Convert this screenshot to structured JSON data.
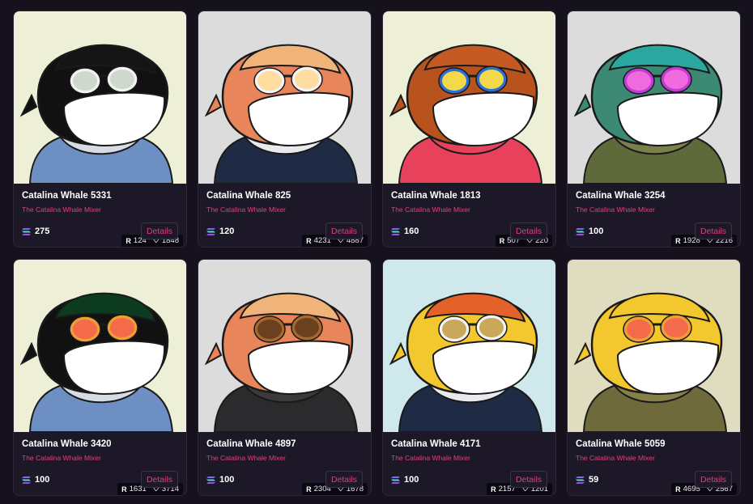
{
  "cards": [
    {
      "title": "Catalina Whale 5331",
      "collection": "The Catalina Whale Mixer",
      "rank": "124",
      "likes": "1848",
      "price": "275",
      "details_label": "Details",
      "bg": "#edf0d6",
      "body": "#111111",
      "hat": "#151515",
      "glasses": "#f2f2f2",
      "lens": "#cfd8cc",
      "outfit": "#6d8fc3",
      "hood": "#d7dbe3"
    },
    {
      "title": "Catalina Whale 825",
      "collection": "The Catalina Whale Mixer",
      "rank": "4231",
      "likes": "4887",
      "price": "120",
      "details_label": "Details",
      "bg": "#dcdcdc",
      "body": "#e8855a",
      "hat": "#f0b37a",
      "glasses": "#f4f4f4",
      "lens": "#ffdca0",
      "outfit": "#1f2a44",
      "hood": "#e9eaee"
    },
    {
      "title": "Catalina Whale 1813",
      "collection": "The Catalina Whale Mixer",
      "rank": "507",
      "likes": "220",
      "price": "160",
      "details_label": "Details",
      "bg": "#edf0d6",
      "body": "#b8531e",
      "hat": "#c45a22",
      "glasses": "#2a6fd6",
      "lens": "#f3d94a",
      "outfit": "#e8415c",
      "hood": "#e8415c"
    },
    {
      "title": "Catalina Whale 3254",
      "collection": "The Catalina Whale Mixer",
      "rank": "1928",
      "likes": "2216",
      "price": "100",
      "details_label": "Details",
      "bg": "#dcdcdc",
      "body": "#3c8a73",
      "hat": "#2aa8a0",
      "glasses": "#c23bd6",
      "lens": "#f06be0",
      "outfit": "#5f6a3a",
      "hood": "#7a7f4c"
    },
    {
      "title": "Catalina Whale 3420",
      "collection": "The Catalina Whale Mixer",
      "rank": "1631",
      "likes": "3714",
      "price": "100",
      "details_label": "Details",
      "bg": "#edf0d6",
      "body": "#111111",
      "hat": "#0d3b1f",
      "glasses": "#f0a032",
      "lens": "#f36b4a",
      "outfit": "#6d8fc3",
      "hood": "#d7dbe3"
    },
    {
      "title": "Catalina Whale 4897",
      "collection": "The Catalina Whale Mixer",
      "rank": "2304",
      "likes": "1678",
      "price": "100",
      "details_label": "Details",
      "bg": "#dcdcdc",
      "body": "#e8855a",
      "hat": "#f0b37a",
      "glasses": "#a86a2a",
      "lens": "#6b4020",
      "outfit": "#2b2b2e",
      "hood": "#3a3a3d"
    },
    {
      "title": "Catalina Whale 4171",
      "collection": "The Catalina Whale Mixer",
      "rank": "2157",
      "likes": "1201",
      "price": "100",
      "details_label": "Details",
      "bg": "#cfe8ec",
      "body": "#f2c82e",
      "hat": "#e4622a",
      "glasses": "#f4f4f4",
      "lens": "#c9a85a",
      "outfit": "#1f2a44",
      "hood": "#e9eaee"
    },
    {
      "title": "Catalina Whale 5059",
      "collection": "The Catalina Whale Mixer",
      "rank": "4695",
      "likes": "2567",
      "price": "59",
      "details_label": "Details",
      "bg": "#e0dcc0",
      "body": "#f2c82e",
      "hat": "#f2c82e",
      "glasses": "#f0a032",
      "lens": "#f36b4a",
      "outfit": "#6e6a3c",
      "hood": "#857f4a"
    }
  ]
}
